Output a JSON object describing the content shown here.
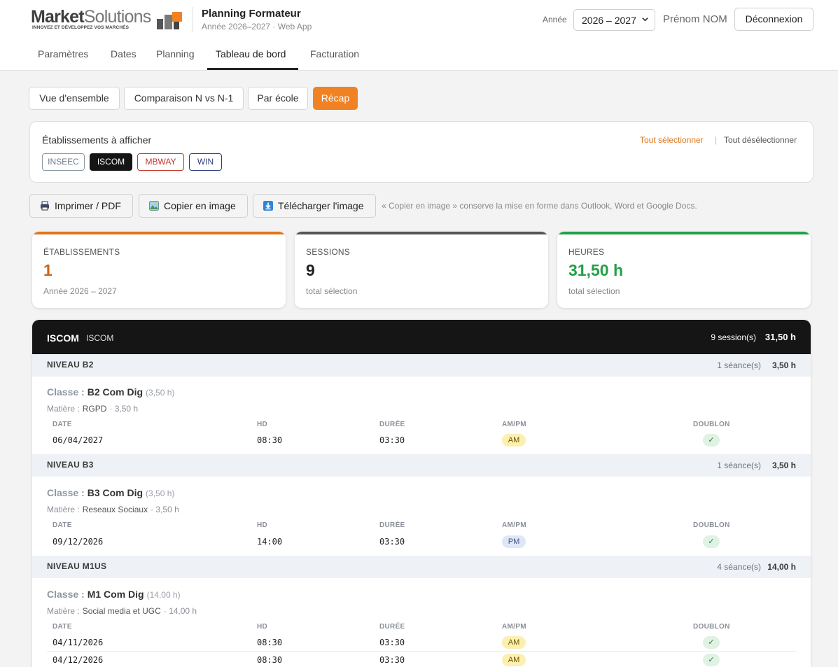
{
  "header": {
    "logo": {
      "word_strong": "Market",
      "word_rest": "Solutions",
      "tagline": "INNOVEZ ET DÉVELOPPEZ VOS MARCHÉS"
    },
    "app_title": "Planning Formateur",
    "app_subtitle": "Année 2026–2027 · Web App",
    "year_label": "Année",
    "year_value": "2026 – 2027",
    "user_name": "Prénom NOM",
    "logout_label": "Déconnexion"
  },
  "nav": {
    "tabs": [
      {
        "label": "Paramètres"
      },
      {
        "label": "Dates"
      },
      {
        "label": "Planning"
      },
      {
        "label": "Tableau de bord",
        "active": true
      },
      {
        "label": "Facturation"
      }
    ]
  },
  "subtabs": [
    {
      "label": "Vue d'ensemble"
    },
    {
      "label": "Comparaison N vs N-1"
    },
    {
      "label": "Par école"
    },
    {
      "label": "Récap",
      "active": true
    }
  ],
  "establishments": {
    "title": "Établissements à afficher",
    "select_all": "Tout sélectionner",
    "divider": "|",
    "deselect_all": "Tout désélectionner",
    "chips": [
      {
        "label": "INSEEC",
        "selected": false,
        "color": "#6b7a8a"
      },
      {
        "label": "ISCOM",
        "selected": true,
        "color": "#151515"
      },
      {
        "label": "MBWAY",
        "selected": false,
        "color": "#c0392b"
      },
      {
        "label": "WIN",
        "selected": false,
        "color": "#2c3e7a"
      }
    ]
  },
  "actions": {
    "print": "Imprimer / PDF",
    "copy": "Copier en image",
    "download": "Télécharger l'image",
    "hint": "« Copier en image » conserve la mise en forme dans Outlook, Word et Google Docs."
  },
  "stats": [
    {
      "label": "ÉTABLISSEMENTS",
      "value": "1",
      "sub": "Année 2026 – 2027",
      "color": "#e0761a",
      "value_color": "#c8651a"
    },
    {
      "label": "SESSIONS",
      "value": "9",
      "sub": "total sélection",
      "color": "#555555",
      "value_color": "#222222"
    },
    {
      "label": "HEURES",
      "value": "31,50 h",
      "sub": "total sélection",
      "color": "#23a047",
      "value_color": "#23a047"
    }
  ],
  "school": {
    "name": "ISCOM",
    "full_name": "ISCOM",
    "sessions": "9 session(s)",
    "hours": "31,50 h",
    "columns": {
      "date": "DATE",
      "hd": "HD",
      "duree": "DURÉE",
      "ampm": "AM/PM",
      "doublon": "DOUBLON"
    },
    "class_key": "Classe :",
    "subject_key": "Matière :",
    "levels": [
      {
        "title": "NIVEAU B2",
        "count": "1 séance(s)",
        "hours": "3,50 h",
        "class_name": "B2 Com Dig",
        "class_hours": "(3,50 h)",
        "subject": "RGPD",
        "subject_hours": "· 3,50 h",
        "rows": [
          {
            "date": "06/04/2027",
            "hd": "08:30",
            "duree": "03:30",
            "ampm": "AM",
            "doublon": "✓"
          }
        ]
      },
      {
        "title": "NIVEAU B3",
        "count": "1 séance(s)",
        "hours": "3,50 h",
        "class_name": "B3 Com Dig",
        "class_hours": "(3,50 h)",
        "subject": "Reseaux Sociaux",
        "subject_hours": "· 3,50 h",
        "rows": [
          {
            "date": "09/12/2026",
            "hd": "14:00",
            "duree": "03:30",
            "ampm": "PM",
            "doublon": "✓"
          }
        ]
      },
      {
        "title": "NIVEAU M1US",
        "count": "4 séance(s)",
        "hours": "14,00 h",
        "class_name": "M1 Com Dig",
        "class_hours": "(14,00 h)",
        "subject": "Social media et UGC",
        "subject_hours": "· 14,00 h",
        "rows": [
          {
            "date": "04/11/2026",
            "hd": "08:30",
            "duree": "03:30",
            "ampm": "AM",
            "doublon": "✓"
          },
          {
            "date": "04/12/2026",
            "hd": "08:30",
            "duree": "03:30",
            "ampm": "AM",
            "doublon": "✓"
          }
        ]
      }
    ]
  },
  "icons": {
    "print": "printer-icon",
    "copy": "image-icon",
    "download": "download-icon",
    "select": "chevron-down-icon"
  }
}
